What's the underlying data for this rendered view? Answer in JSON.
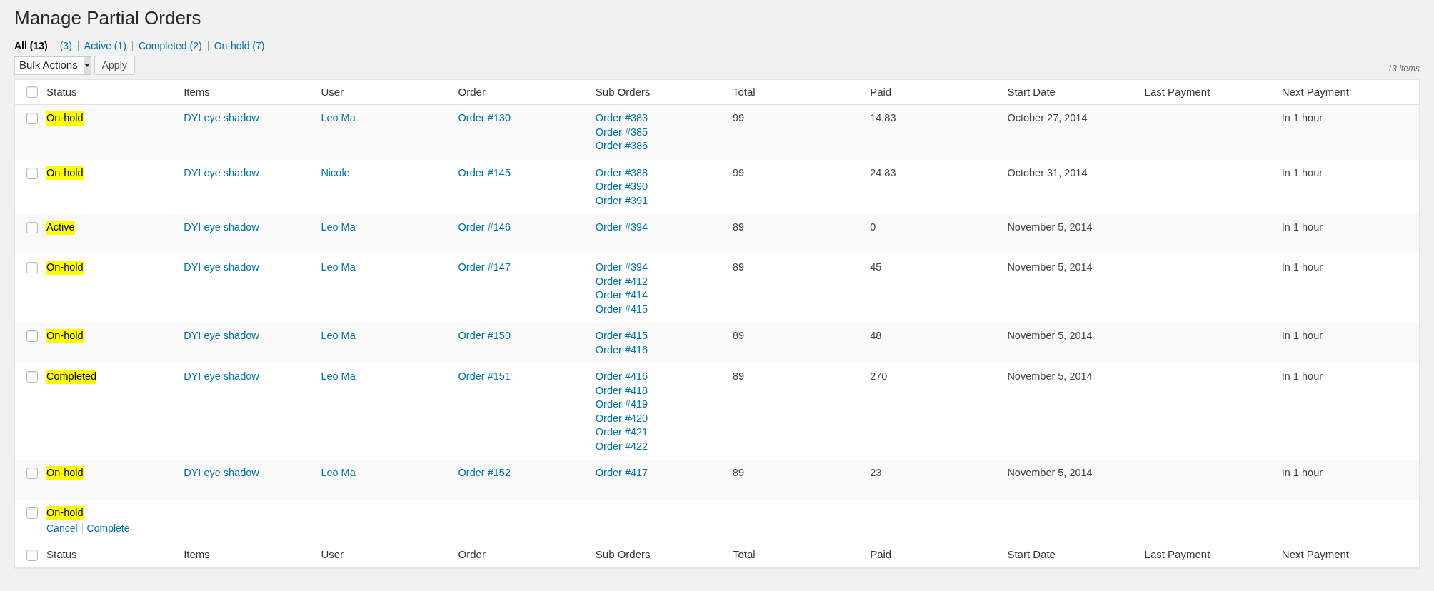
{
  "page_title": "Manage Partial Orders",
  "filters": [
    {
      "label": "All (13)",
      "selected": true
    },
    {
      "label": "(3)",
      "selected": false
    },
    {
      "label": "Active (1)",
      "selected": false
    },
    {
      "label": "Completed (2)",
      "selected": false
    },
    {
      "label": "On-hold (7)",
      "selected": false
    }
  ],
  "bulk_actions": {
    "value": "Bulk Actions",
    "apply": "Apply"
  },
  "item_count": "13 items",
  "columns": [
    "Status",
    "Items",
    "User",
    "Order",
    "Sub Orders",
    "Total",
    "Paid",
    "Start Date",
    "Last Payment",
    "Next Payment"
  ],
  "select_all_checked": false,
  "rows": [
    {
      "checked": false,
      "status": "On-hold",
      "items": "DYI eye shadow",
      "user": "Leo Ma",
      "order": "Order #130",
      "sub_orders": [
        "Order #383",
        "Order #385",
        "Order #386"
      ],
      "total": "99",
      "paid": "14.83",
      "start_date": "October 27, 2014",
      "next_payment": "In 1 hour"
    },
    {
      "checked": false,
      "status": "On-hold",
      "items": "DYI eye shadow",
      "user": "Nicole",
      "order": "Order #145",
      "sub_orders": [
        "Order #388",
        "Order #390",
        "Order #391"
      ],
      "total": "99",
      "paid": "24.83",
      "start_date": "October 31, 2014",
      "next_payment": "In 1 hour"
    },
    {
      "checked": false,
      "status": "Active",
      "items": "DYI eye shadow",
      "user": "Leo Ma",
      "order": "Order #146",
      "sub_orders": [
        "Order #394"
      ],
      "total": "89",
      "paid": "0",
      "start_date": "November 5, 2014",
      "next_payment": "In 1 hour"
    },
    {
      "checked": false,
      "status": "On-hold",
      "items": "DYI eye shadow",
      "user": "Leo Ma",
      "order": "Order #147",
      "sub_orders": [
        "Order #394",
        "Order #412",
        "Order #414",
        "Order #415"
      ],
      "total": "89",
      "paid": "45",
      "start_date": "November 5, 2014",
      "next_payment": "In 1 hour"
    },
    {
      "checked": false,
      "status": "On-hold",
      "items": "DYI eye shadow",
      "user": "Leo Ma",
      "order": "Order #150",
      "sub_orders": [
        "Order #415",
        "Order #416"
      ],
      "total": "89",
      "paid": "48",
      "start_date": "November 5, 2014",
      "next_payment": "In 1 hour"
    },
    {
      "checked": false,
      "status": "Completed",
      "items": "DYI eye shadow",
      "user": "Leo Ma",
      "order": "Order #151",
      "sub_orders": [
        "Order #416",
        "Order #418",
        "Order #419",
        "Order #420",
        "Order #421",
        "Order #422"
      ],
      "total": "89",
      "paid": "270",
      "start_date": "November 5, 2014",
      "next_payment": "In 1 hour"
    },
    {
      "checked": false,
      "status": "On-hold",
      "items": "DYI eye shadow",
      "user": "Leo Ma",
      "order": "Order #152",
      "sub_orders": [
        "Order #417"
      ],
      "total": "89",
      "paid": "23",
      "start_date": "November 5, 2014",
      "next_payment": "In 1 hour"
    },
    {
      "checked": false,
      "status": "On-hold",
      "actions": [
        "Cancel",
        "Complete"
      ]
    }
  ],
  "footer_columns": [
    "Status",
    "Items",
    "User",
    "Order",
    "Sub Orders",
    "Total",
    "Paid",
    "Start Date",
    "Last Payment",
    "Next Payment"
  ],
  "footer_select_all_checked": false
}
